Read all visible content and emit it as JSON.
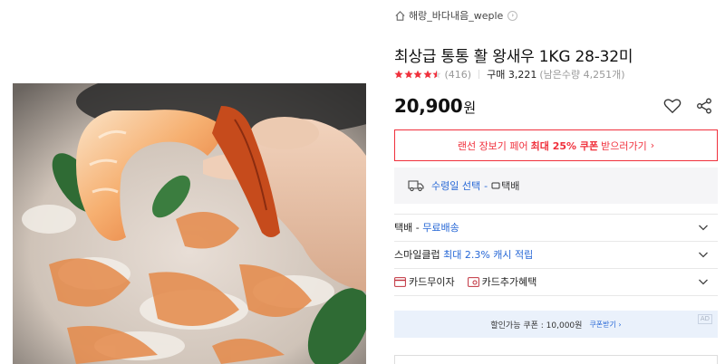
{
  "seller": {
    "name": "해랑_바다내음_weple",
    "arrow": "›"
  },
  "product": {
    "title": "최상급 통통 활 왕새우 1KG 28-32미",
    "rating": 4.5,
    "review_count": "(416)",
    "purchase": "구매 3,221",
    "remaining": "(남은수량 4,251개)",
    "price": "20,900",
    "price_unit": "원"
  },
  "coupon": {
    "prefix": "랜선 장보기 페어",
    "highlight": "최대 25% 쿠폰",
    "suffix": "받으러가기",
    "chevron": "›"
  },
  "delivery": {
    "date_label": "수령일 선택",
    "separator": "-",
    "type": "택배"
  },
  "shipping": {
    "label": "택배 -",
    "value": "무료배송"
  },
  "smileclub": {
    "label": "스마일클럽",
    "value": "최대 2.3% 캐시 적립"
  },
  "cards": {
    "interest_free": "카드무이자",
    "extra_benefit": "카드추가혜택"
  },
  "ad": {
    "text": "할인가능 쿠폰 : 10,000원",
    "link": "쿠폰받기 ›",
    "badge": "AD"
  },
  "colors": {
    "accent_red": "#f0303c",
    "accent_blue": "#2667d6",
    "star": "#f0303c",
    "ad_bg": "#eaf1fb"
  }
}
